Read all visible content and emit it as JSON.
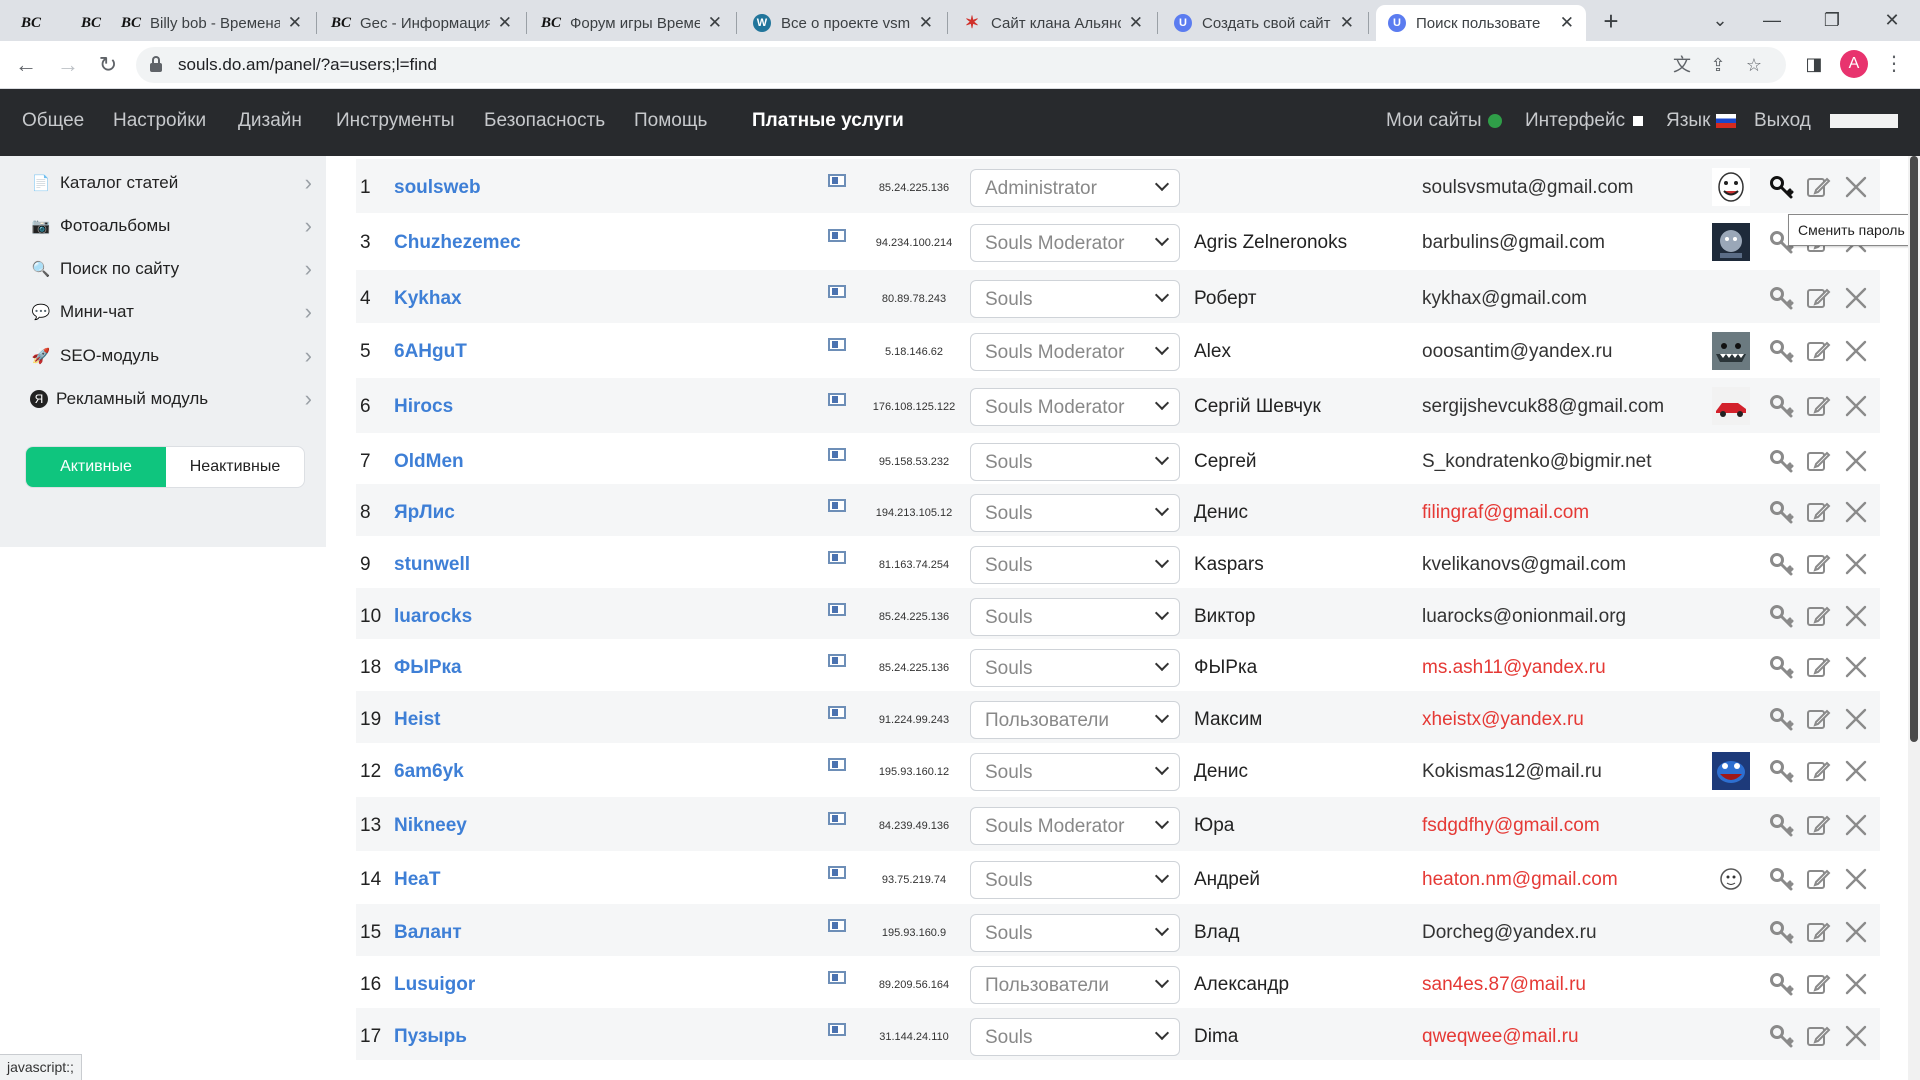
{
  "browser": {
    "tabs": [
      {
        "favicon": "BC",
        "title": ""
      },
      {
        "favicon": "BC",
        "title": ""
      },
      {
        "favicon": "BC",
        "title": "Billy bob - Времена"
      },
      {
        "favicon": "BC",
        "title": "Gec - Информация"
      },
      {
        "favicon": "BC",
        "title": "Форум игры Време"
      },
      {
        "favicon": "W",
        "title": "Все о проекте vsmu"
      },
      {
        "favicon": "✶",
        "title": "Сайт клана Альянс"
      },
      {
        "favicon": "U",
        "title": "Создать свой сайт"
      },
      {
        "favicon": "U",
        "title": "Поиск пользовате"
      }
    ],
    "url": "souls.do.am/panel/?a=users;l=find",
    "profile_initial": "A",
    "status_text": "javascript:;"
  },
  "nav": {
    "items": [
      "Общее",
      "Настройки",
      "Дизайн",
      "Инструменты",
      "Безопасность",
      "Помощь",
      "Платные услуги"
    ],
    "right": {
      "my_sites": "Мои сайты",
      "interface": "Интерфейс",
      "language": "Язык",
      "logout": "Выход"
    }
  },
  "sidebar": {
    "items": [
      {
        "icon": "article-catalog-icon",
        "label": "Каталог статей"
      },
      {
        "icon": "photo-album-icon",
        "label": "Фотоальбомы"
      },
      {
        "icon": "magnifier-icon",
        "label": "Поиск по сайту"
      },
      {
        "icon": "chat-icon",
        "label": "Мини-чат"
      },
      {
        "icon": "rocket-icon",
        "label": "SEO-модуль"
      },
      {
        "icon": "yandex-icon",
        "label": "Рекламный модуль"
      }
    ],
    "toggle": {
      "active": "Активные",
      "inactive": "Неактивные"
    }
  },
  "users": [
    {
      "num": "1",
      "login": "soulsweb",
      "ip": "85.24.225.136",
      "group": "Administrator",
      "name": "",
      "email": "soulsvsmuta@gmail.com",
      "email_warn": false,
      "avatar": "smiley"
    },
    {
      "num": "3",
      "login": "Chuzhezemec",
      "ip": "94.234.100.214",
      "group": "Souls Moderator",
      "name": "Agris Zelneronoks",
      "email": "barbulins@gmail.com",
      "email_warn": false,
      "avatar": "dark"
    },
    {
      "num": "4",
      "login": "Kykhax",
      "ip": "80.89.78.243",
      "group": "Souls",
      "name": "Роберт",
      "email": "kykhax@gmail.com",
      "email_warn": false,
      "avatar": ""
    },
    {
      "num": "5",
      "login": "6AHguT",
      "ip": "5.18.146.62",
      "group": "Souls Moderator",
      "name": "Alex",
      "email": "ooosantim@yandex.ru",
      "email_warn": false,
      "avatar": "shark"
    },
    {
      "num": "6",
      "login": "Hirocs",
      "ip": "176.108.125.122",
      "group": "Souls Moderator",
      "name": "Сергій Шевчук",
      "email": "sergijshevcuk88@gmail.com",
      "email_warn": false,
      "avatar": "car"
    },
    {
      "num": "7",
      "login": "OldMen",
      "ip": "95.158.53.232",
      "group": "Souls",
      "name": "Сергей",
      "email": "S_kondratenko@bigmir.net",
      "email_warn": false,
      "avatar": ""
    },
    {
      "num": "8",
      "login": "ЯрЛис",
      "ip": "194.213.105.12",
      "group": "Souls",
      "name": "Денис",
      "email": "filingraf@gmail.com",
      "email_warn": true,
      "avatar": ""
    },
    {
      "num": "9",
      "login": "stunwell",
      "ip": "81.163.74.254",
      "group": "Souls",
      "name": "Kaspars",
      "email": "kvelikanovs@gmail.com",
      "email_warn": false,
      "avatar": ""
    },
    {
      "num": "10",
      "login": "luarocks",
      "ip": "85.24.225.136",
      "group": "Souls",
      "name": "Виктор",
      "email": "luarocks@onionmail.org",
      "email_warn": false,
      "avatar": ""
    },
    {
      "num": "18",
      "login": "ФЫРка",
      "ip": "85.24.225.136",
      "group": "Souls",
      "name": "ФЫРка",
      "email": "ms.ash11@yandex.ru",
      "email_warn": true,
      "avatar": ""
    },
    {
      "num": "19",
      "login": "Heist",
      "ip": "91.224.99.243",
      "group": "Пользователи",
      "name": "Максим",
      "email": "xheistx@yandex.ru",
      "email_warn": true,
      "avatar": ""
    },
    {
      "num": "12",
      "login": "6am6yk",
      "ip": "195.93.160.12",
      "group": "Souls",
      "name": "Денис",
      "email": "Kokismas12@mail.ru",
      "email_warn": false,
      "avatar": "monster"
    },
    {
      "num": "13",
      "login": "Nikneey",
      "ip": "84.239.49.136",
      "group": "Souls Moderator",
      "name": "Юра",
      "email": "fsdgdfhy@gmail.com",
      "email_warn": true,
      "avatar": ""
    },
    {
      "num": "14",
      "login": "HeaT",
      "ip": "93.75.219.74",
      "group": "Souls",
      "name": "Андрей",
      "email": "heaton.nm@gmail.com",
      "email_warn": true,
      "avatar": "sketch"
    },
    {
      "num": "15",
      "login": "Валант",
      "ip": "195.93.160.9",
      "group": "Souls",
      "name": "Влад",
      "email": "Dorcheg@yandex.ru",
      "email_warn": false,
      "avatar": ""
    },
    {
      "num": "16",
      "login": "Lusuigor",
      "ip": "89.209.56.164",
      "group": "Пользователи",
      "name": "Александр",
      "email": "san4es.87@mail.ru",
      "email_warn": true,
      "avatar": ""
    },
    {
      "num": "17",
      "login": "Пузырь",
      "ip": "31.144.24.110",
      "group": "Souls",
      "name": "Dima",
      "email": "qweqwee@mail.ru",
      "email_warn": true,
      "avatar": ""
    }
  ],
  "tooltip": "Сменить пароль",
  "colors": {
    "accent_green": "#0fc57e",
    "link_blue": "#3e7fd6",
    "warn_red": "#e53935",
    "nav_bg": "#282a2d"
  }
}
